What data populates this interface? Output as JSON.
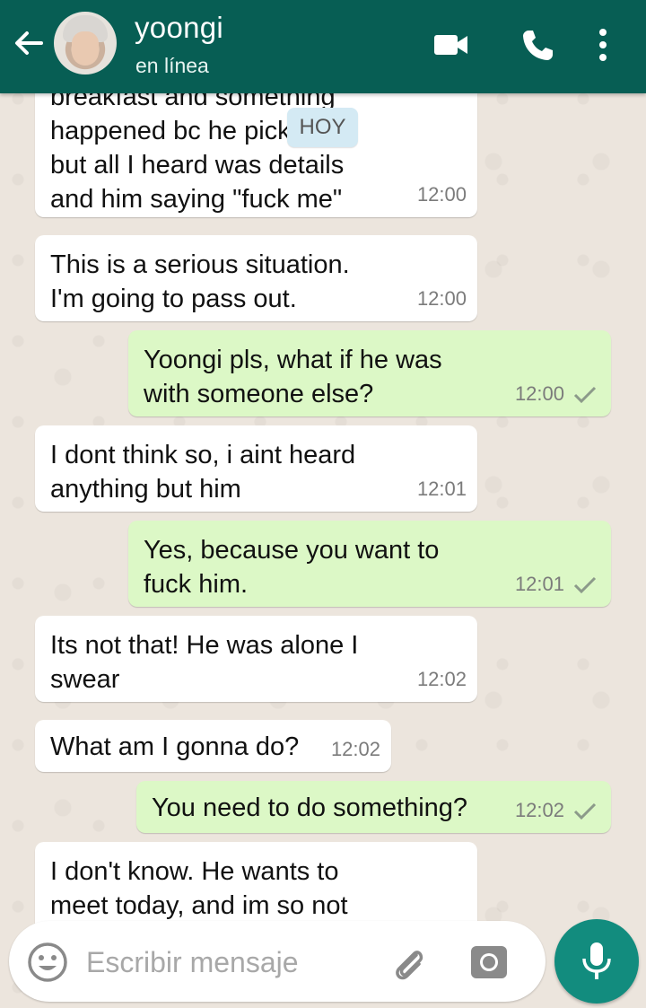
{
  "header": {
    "contact_name": "yoongi",
    "status": "en línea",
    "icons": [
      "back-arrow-icon",
      "video-call-icon",
      "voice-call-icon",
      "more-options-icon"
    ]
  },
  "date_chip": "HOY",
  "messages": [
    {
      "direction": "in",
      "text": "breakfast and something\nhappened bc he picked up\nbut all I heard was details\nand him saying \"fuck me\"",
      "time": "12:00"
    },
    {
      "direction": "in",
      "text": "This is a serious situation.\nI'm going to pass out.",
      "time": "12:00"
    },
    {
      "direction": "out",
      "text": "Yoongi pls, what if he was\nwith someone else?",
      "time": "12:00"
    },
    {
      "direction": "in",
      "text": "I dont think so, i aint heard\nanything but him",
      "time": "12:01"
    },
    {
      "direction": "out",
      "text": "Yes, because you want to\nfuck him.",
      "time": "12:01"
    },
    {
      "direction": "in",
      "text": "Its not that! He was alone I\nswear",
      "time": "12:02"
    },
    {
      "direction": "in",
      "text": "What am I gonna do?",
      "time": "12:02"
    },
    {
      "direction": "out",
      "text": "You need to do something?",
      "time": "12:02"
    },
    {
      "direction": "in",
      "text": "I don't know. He wants to\nmeet today, and im so not",
      "time": ""
    }
  ],
  "composer": {
    "placeholder": "Escribir mensaje",
    "icons": [
      "emoji-icon",
      "attach-icon",
      "camera-icon",
      "mic-icon"
    ]
  },
  "colors": {
    "header": "#075e54",
    "outgoing_bubble": "#dcf8c6",
    "incoming_bubble": "#ffffff",
    "chat_background": "#ece5dd",
    "mic_button": "#128c7e"
  }
}
